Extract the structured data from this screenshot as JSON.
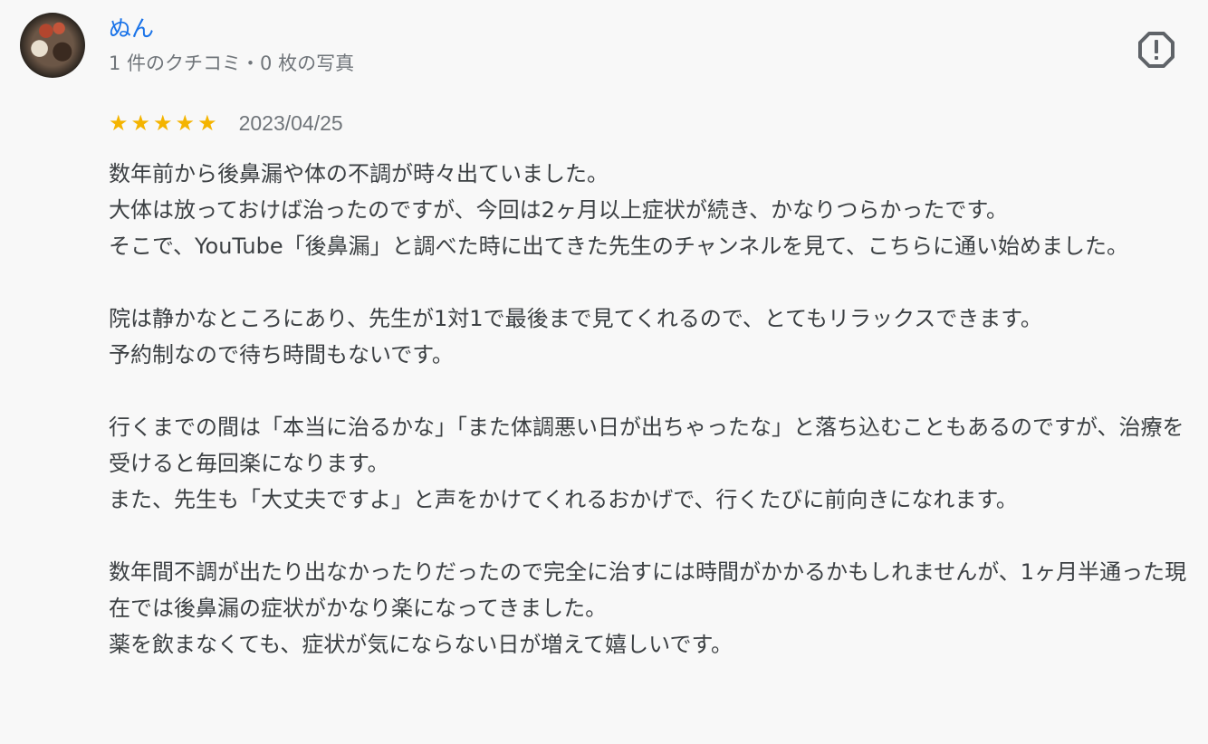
{
  "reviewer": {
    "name": "ぬん",
    "meta": "1 件のクチコミ・0 枚の写真",
    "avatar_icon": "user-avatar-photo"
  },
  "report_icon": "report-flag-icon",
  "rating": {
    "stars": 5,
    "max": 5,
    "star_glyph": "★",
    "date": "2023/04/25",
    "star_color": "#f4b400"
  },
  "review": {
    "paragraphs": [
      "数年前から後鼻漏や体の不調が時々出ていました。\n大体は放っておけば治ったのですが、今回は2ヶ月以上症状が続き、かなりつらかったです。\nそこで、YouTube「後鼻漏」と調べた時に出てきた先生のチャンネルを見て、こちらに通い始めました。",
      "院は静かなところにあり、先生が1対1で最後まで見てくれるので、とてもリラックスできます。\n予約制なので待ち時間もないです。",
      "行くまでの間は「本当に治るかな」「また体調悪い日が出ちゃったな」と落ち込むこともあるのですが、治療を受けると毎回楽になります。\nまた、先生も「大丈夫ですよ」と声をかけてくれるおかげで、行くたびに前向きになれます。",
      "数年間不調が出たり出なかったりだったので完全に治すには時間がかかるかもしれませんが、1ヶ月半通った現在では後鼻漏の症状がかなり楽になってきました。\n薬を飲まなくても、症状が気にならない日が増えて嬉しいです。"
    ]
  },
  "colors": {
    "name_link": "#1a73e8",
    "meta_text": "#70757a",
    "body_text": "#3c4043",
    "background": "#f8f8f8"
  }
}
